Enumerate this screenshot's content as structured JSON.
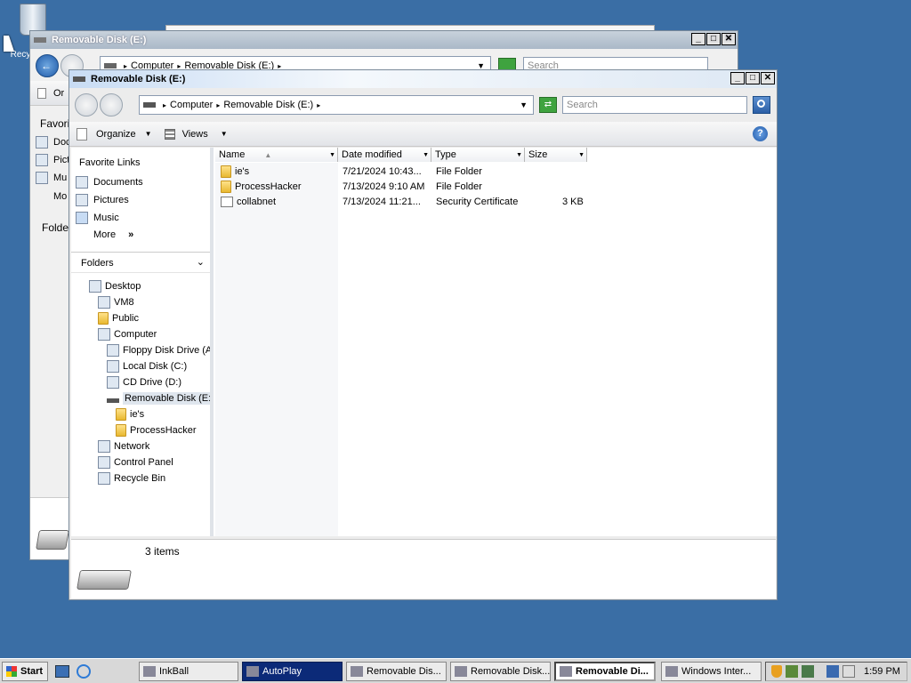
{
  "desktop": {
    "recycle_label": "Recycle Bin",
    "colors": {
      "background": "#3a6ea5"
    }
  },
  "back_window_1": {
    "title": "Removable Disk (E:)",
    "breadcrumb": [
      "Computer",
      "Removable Disk (E:)"
    ],
    "search_placeholder": "Search",
    "toolbar_stub": "Or",
    "fav_stub": "Favori",
    "nav_stubs": [
      "Doc",
      "Pict",
      "Mu",
      "Mo"
    ],
    "folders_stub": "Folde"
  },
  "main_window": {
    "title": "Removable Disk (E:)",
    "breadcrumb": [
      "Computer",
      "Removable Disk (E:)"
    ],
    "search_placeholder": "Search",
    "toolbar": {
      "organize": "Organize",
      "views": "Views"
    },
    "favorite_links": {
      "header": "Favorite Links",
      "items": [
        "Documents",
        "Pictures",
        "Music"
      ],
      "more": "More"
    },
    "folders": {
      "header": "Folders",
      "items": [
        {
          "label": "Desktop",
          "icon": "desktop-icon"
        },
        {
          "label": "VM8",
          "icon": "user-folder-icon"
        },
        {
          "label": "Public",
          "icon": "folder-icon"
        },
        {
          "label": "Computer",
          "icon": "computer-icon"
        },
        {
          "label": "Floppy Disk Drive (A",
          "icon": "floppy-icon"
        },
        {
          "label": "Local Disk (C:)",
          "icon": "hard-disk-icon"
        },
        {
          "label": "CD Drive (D:)",
          "icon": "cd-drive-icon"
        },
        {
          "label": "Removable Disk (E:)",
          "icon": "removable-disk-icon",
          "selected": true
        },
        {
          "label": "ie's",
          "icon": "folder-icon"
        },
        {
          "label": "ProcessHacker",
          "icon": "folder-icon"
        },
        {
          "label": "Network",
          "icon": "network-icon"
        },
        {
          "label": "Control Panel",
          "icon": "control-panel-icon"
        },
        {
          "label": "Recycle Bin",
          "icon": "recycle-bin-icon"
        }
      ]
    },
    "columns": [
      "Name",
      "Date modified",
      "Type",
      "Size"
    ],
    "files": [
      {
        "name": "ie's",
        "date": "7/21/2024 10:43...",
        "type": "File Folder",
        "size": "",
        "icon": "folder-icon"
      },
      {
        "name": "ProcessHacker",
        "date": "7/13/2024 9:10 AM",
        "type": "File Folder",
        "size": "",
        "icon": "folder-icon"
      },
      {
        "name": "collabnet",
        "date": "7/13/2024 11:21...",
        "type": "Security Certificate",
        "size": "3 KB",
        "icon": "certificate-icon"
      }
    ],
    "status": {
      "item_count": "3 items"
    }
  },
  "taskbar": {
    "start": "Start",
    "tasks": [
      {
        "label": "InkBall",
        "style": "normal"
      },
      {
        "label": "AutoPlay",
        "style": "dark"
      },
      {
        "label": "Removable Dis...",
        "style": "normal"
      },
      {
        "label": "Removable Disk...",
        "style": "normal"
      },
      {
        "label": "Removable Di...",
        "style": "pressed"
      },
      {
        "label": "Windows Inter...",
        "style": "normal"
      }
    ],
    "clock": "1:59 PM"
  }
}
